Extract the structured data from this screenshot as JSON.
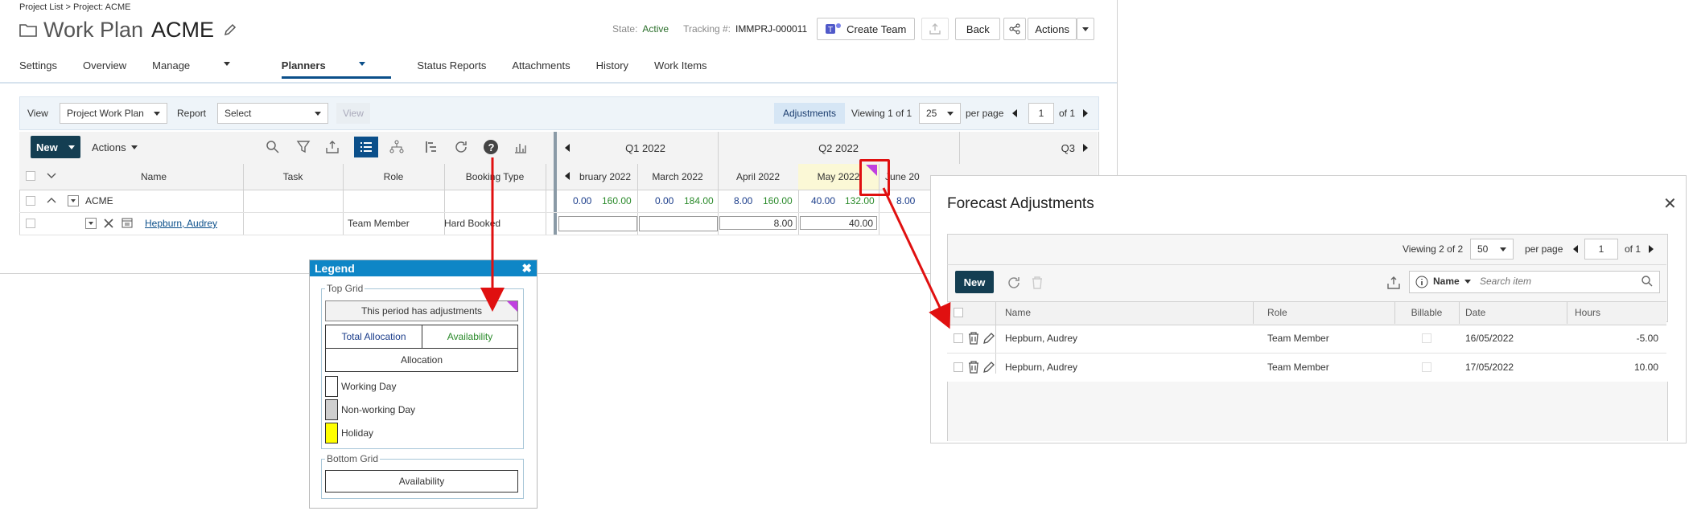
{
  "breadcrumb": "Project List > Project: ACME",
  "page": {
    "title_prefix": "Work Plan",
    "title_name": "ACME"
  },
  "header": {
    "state_label": "State:",
    "state_value": "Active",
    "tracking_label": "Tracking #:",
    "tracking_value": "IMMPRJ-000011",
    "create_team": "Create Team",
    "back": "Back",
    "actions": "Actions"
  },
  "tabs": [
    "Settings",
    "Overview",
    "Manage",
    "Planners",
    "Status Reports",
    "Attachments",
    "History",
    "Work Items"
  ],
  "toolbar": {
    "view_label": "View",
    "view_value": "Project Work Plan",
    "report_label": "Report",
    "report_value": "Select",
    "view_button": "View",
    "adjustments": "Adjustments",
    "viewing_prefix": "Viewing",
    "viewing_range": "1 of 1",
    "per_page_value": "25",
    "per_page_label": "per page",
    "page_value": "1",
    "page_of": "of 1"
  },
  "grid_toolbar": {
    "new": "New",
    "actions": "Actions"
  },
  "grid": {
    "columns": [
      "Name",
      "Task",
      "Role",
      "Booking Type"
    ],
    "quarters": [
      "Q1 2022",
      "Q2 2022",
      "Q3"
    ],
    "months": [
      "bruary 2022",
      "March 2022",
      "April 2022",
      "May 2022",
      "June 20"
    ],
    "rows": [
      {
        "name": "ACME",
        "values": [
          "0.00",
          "160.00",
          "0.00",
          "184.00",
          "8.00",
          "160.00",
          "40.00",
          "132.00",
          "8.00"
        ]
      },
      {
        "name": "Hepburn, Audrey",
        "role": "Team Member",
        "booking": "Hard Booked",
        "hours": [
          "8.00",
          "40.00"
        ]
      }
    ]
  },
  "legend": {
    "title": "Legend",
    "top_grid": "Top Grid",
    "adjustments_text": "This period has adjustments",
    "total_allocation": "Total Allocation",
    "availability": "Availability",
    "allocation": "Allocation",
    "working_day": "Working Day",
    "non_working_day": "Non-working Day",
    "holiday": "Holiday",
    "bottom_grid": "Bottom Grid",
    "bottom_availability": "Availability"
  },
  "forecast": {
    "title": "Forecast Adjustments",
    "viewing_prefix": "Viewing",
    "viewing_range": "2 of 2",
    "per_page_value": "50",
    "per_page_label": "per page",
    "page_value": "1",
    "page_of": "of 1",
    "new": "New",
    "sort_field": "Name",
    "search_placeholder": "Search item",
    "columns": [
      "Name",
      "Role",
      "Billable",
      "Date",
      "Hours"
    ],
    "rows": [
      {
        "name": "Hepburn, Audrey",
        "role": "Team Member",
        "date": "16/05/2022",
        "hours": "-5.00"
      },
      {
        "name": "Hepburn, Audrey",
        "role": "Team Member",
        "date": "17/05/2022",
        "hours": "10.00"
      }
    ]
  },
  "colors": {
    "accent": "#0b4f8a",
    "dark_button": "#143e52",
    "legend_head": "#0e86c6",
    "callout": "#e01010",
    "adjust_marker": "#c040e0",
    "holiday": "#ffff00"
  }
}
